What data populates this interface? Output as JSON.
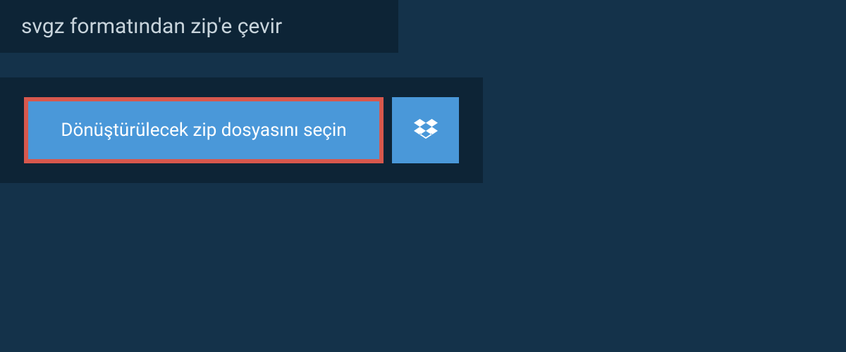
{
  "header": {
    "title": "svgz formatından zip'e çevir"
  },
  "actions": {
    "select_file_label": "Dönüştürülecek zip dosyasını seçin",
    "dropbox_icon": "dropbox-icon"
  },
  "colors": {
    "background": "#14324a",
    "panel": "#0d2436",
    "button": "#4a98d9",
    "highlight_border": "#d7584d",
    "text_light": "#c8d4dc"
  }
}
